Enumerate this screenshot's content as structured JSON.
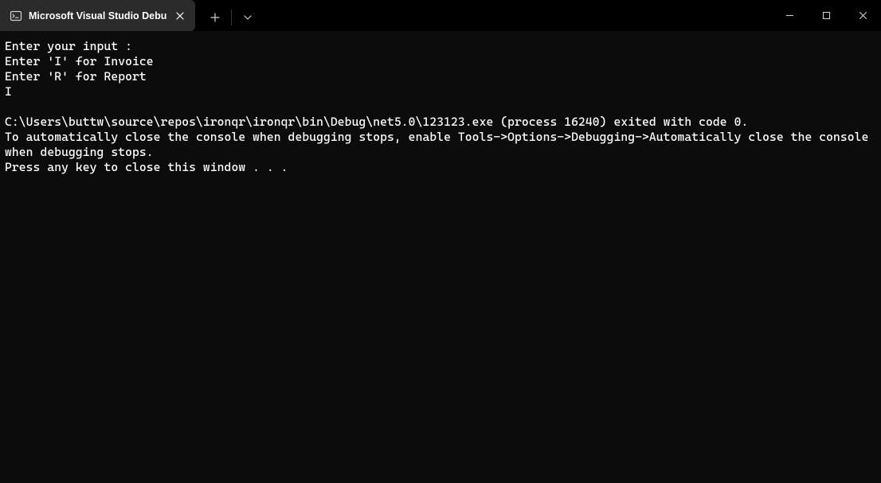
{
  "titlebar": {
    "tab_title": "Microsoft Visual Studio Debug Console",
    "tab_icon": "console-icon"
  },
  "console": {
    "lines": [
      "Enter your input :",
      "Enter 'I' for Invoice",
      "Enter 'R' for Report",
      "I",
      "",
      "C:\\Users\\buttw\\source\\repos\\ironqr\\ironqr\\bin\\Debug\\net5.0\\123123.exe (process 16240) exited with code 0.",
      "To automatically close the console when debugging stops, enable Tools->Options->Debugging->Automatically close the console when debugging stops.",
      "Press any key to close this window . . ."
    ]
  }
}
